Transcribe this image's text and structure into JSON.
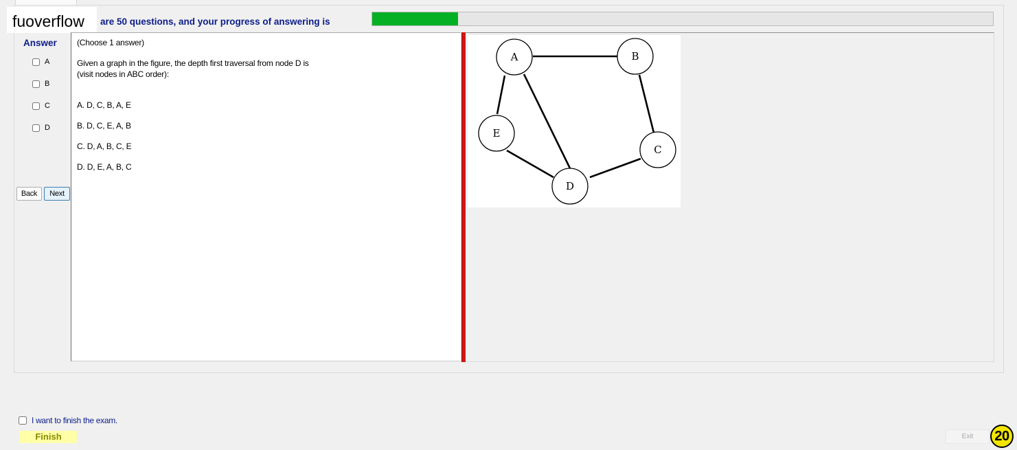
{
  "watermark": "fuoverflow",
  "header": {
    "progress_text": "are 50 questions, and your progress of answering is",
    "progress_fraction": 0.138
  },
  "answer_panel": {
    "title": "Answer",
    "options": [
      "A",
      "B",
      "C",
      "D"
    ],
    "back_label": "Back",
    "next_label": "Next"
  },
  "question": {
    "instruction": "(Choose 1 answer)",
    "text_line1": "Given a graph in the figure, the depth first traversal from node D is",
    "text_line2": "(visit nodes in ABC order):",
    "choices": [
      "A.  D, C, B, A, E",
      "B.  D, C, E, A, B",
      "C.  D, A, B, C, E",
      "D.  D, E, A, B, C"
    ]
  },
  "graph": {
    "nodes": [
      "A",
      "B",
      "C",
      "D",
      "E"
    ],
    "edges": [
      [
        "A",
        "B"
      ],
      [
        "A",
        "E"
      ],
      [
        "A",
        "D"
      ],
      [
        "B",
        "C"
      ],
      [
        "E",
        "D"
      ],
      [
        "D",
        "C"
      ]
    ]
  },
  "footer": {
    "finish_checkbox_label": "I want to finish the exam.",
    "finish_label": "Finish",
    "exit_label": "Exit",
    "page_number": "20"
  },
  "colors": {
    "accent_text": "#0c1c8a",
    "progress_fill": "#06b025",
    "splitter": "#d21515",
    "finish_bg": "#ffffa8",
    "badge": "#f2e600"
  }
}
